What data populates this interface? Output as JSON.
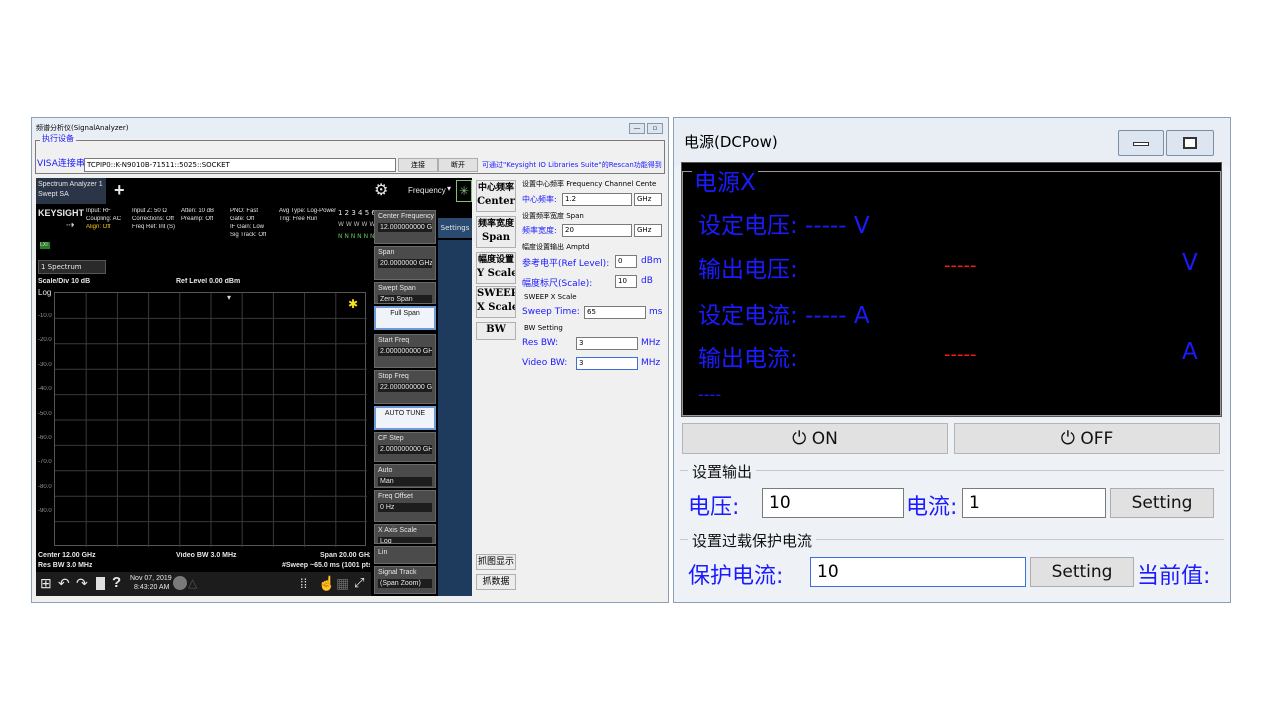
{
  "left_window": {
    "title": "频谱分析仪(SignalAnalyzer)",
    "minimize_glyph": "—",
    "restore_glyph": "▫",
    "config_legend": "执行设备",
    "visa_label": "VISA连接串",
    "visa_value": "TCPIP0::K-N9010B-71511::5025::SOCKET",
    "connect_button": "连接",
    "disconnect_button": "断开",
    "hint": "可通过\"Keysight IO Libraries Suite\"的Rescan功能得到",
    "instrument": {
      "tab_line1": "Spectrum Analyzer 1",
      "tab_line2": "Swept SA",
      "add_tab": "+",
      "gear_glyph": "⚙",
      "frequency_menu": "Frequency",
      "settings_tab": "Settings",
      "logo": "KEYSIGHT",
      "lxi_badge": "LXI",
      "status_cols": [
        [
          "Input: RF",
          "Coupling: AC",
          "Align: Off"
        ],
        [
          "Input Z: 50 Ω",
          "Corrections: Off",
          "Freq Ref: Int (S)"
        ],
        [
          "Atten: 10 dB",
          "Preamp: Off"
        ],
        [
          "PNO: Fast",
          "Gate: Off",
          "IF Gain: Low",
          "Sig Track: Off"
        ],
        [
          "Avg Type: Log-Power",
          "Trig: Free Run"
        ]
      ],
      "trace_numbers": "1 2 3 4 5 6",
      "trace_row2": "W W W W W W",
      "trace_row3": "N N N N N N",
      "window_select": "1 Spectrum",
      "scale_div": "Scale/Div 10 dB",
      "ref_level": "Ref Level 0.00 dBm",
      "log_label": "Log",
      "y_ticks": [
        "-10.0",
        "-20.0",
        "-30.0",
        "-40.0",
        "-50.0",
        "-60.0",
        "-70.0",
        "-80.0",
        "-90.0"
      ],
      "center": "Center 12.00 GHz",
      "res_bw": "Res BW 3.0 MHz",
      "video_bw": "Video BW 3.0 MHz",
      "span": "Span 20.00 GHz",
      "sweep": "#Sweep ~65.0 ms (1001 pts)",
      "date": "Nov 07, 2019",
      "time": "8:43:20 AM",
      "softkeys": [
        {
          "label": "Center Frequency",
          "value": "12.000000000 GHz"
        },
        {
          "label": "Span",
          "value": "20.0000000 GHz"
        },
        {
          "label": "Swept Span",
          "value": "Zero Span"
        },
        {
          "label": "Full Span",
          "value": ""
        },
        {
          "label": "Start Freq",
          "value": "2.000000000 GHz"
        },
        {
          "label": "Stop Freq",
          "value": "22.000000000 GHz"
        },
        {
          "label": "AUTO TUNE",
          "value": ""
        },
        {
          "label": "CF Step",
          "value": "2.000000000 GHz"
        },
        {
          "label": "Auto",
          "value": "Man"
        },
        {
          "label": "Freq Offset",
          "value": "0 Hz"
        },
        {
          "label": "X Axis Scale",
          "value": "Log"
        },
        {
          "label": "Lin",
          "value": ""
        },
        {
          "label": "Signal Track",
          "value": "(Span Zoom)"
        }
      ]
    },
    "mid_buttons": [
      {
        "line1": "中心频率",
        "line2": "Center"
      },
      {
        "line1": "频率宽度",
        "line2": "Span"
      },
      {
        "line1": "幅度设置",
        "line2": "Y Scale"
      },
      {
        "line1": "SWEEP",
        "line2": "X Scale"
      },
      {
        "line1": "BW",
        "line2": ""
      }
    ],
    "capture_display": "抓图显示",
    "capture_data": "抓数据",
    "settings": {
      "center_group": "设置中心频率 Frequency Channel Cente",
      "center_label": "中心频率:",
      "center_value": "1.2",
      "center_unit": "GHz",
      "span_group": "设置频率宽度 Span",
      "span_label": "频率宽度:",
      "span_value": "20",
      "span_unit": "GHz",
      "ampt_group": "幅度设置输出 Amptd",
      "ref_label": "参考电平(Ref Level):",
      "ref_value": "0",
      "ref_unit": "dBm",
      "scale_label": "幅度标尺(Scale):",
      "scale_value": "10",
      "scale_unit": "dB",
      "sweep_group": "SWEEP X Scale",
      "sweep_label": "Sweep Time:",
      "sweep_value": "65",
      "sweep_unit": "ms",
      "bw_group": "BW Setting",
      "res_label": "Res BW:",
      "res_value": "3",
      "res_unit": "MHz",
      "video_label": "Video BW:",
      "video_value": "3",
      "video_unit": "MHz"
    }
  },
  "right_window": {
    "title": "电源(DCPow)",
    "group_title": "电源X",
    "set_voltage_label": "设定电压: ----- V",
    "out_voltage_label": "输出电压:",
    "out_voltage_value": "-----",
    "out_voltage_unit": "V",
    "set_current_label": "设定电流: ----- A",
    "out_current_label": "输出电流:",
    "out_current_value": "-----",
    "out_current_unit": "A",
    "bottom_dashes": "----",
    "on_button": "ON",
    "off_button": "OFF",
    "output_section": "设置输出",
    "voltage_label": "电压:",
    "voltage_value": "10",
    "current_label": "电流:",
    "current_value": "1",
    "setting_button_1": "Setting",
    "ocp_section": "设置过载保护电流",
    "protect_label": "保护电流:",
    "protect_value": "10",
    "setting_button_2": "Setting",
    "current_value_label": "当前值:"
  },
  "colors": {
    "label_blue": "#1b1bff",
    "value_red": "#ff1a1a",
    "display_bg": "#000000",
    "trace_yellow": "#f5e21b"
  }
}
